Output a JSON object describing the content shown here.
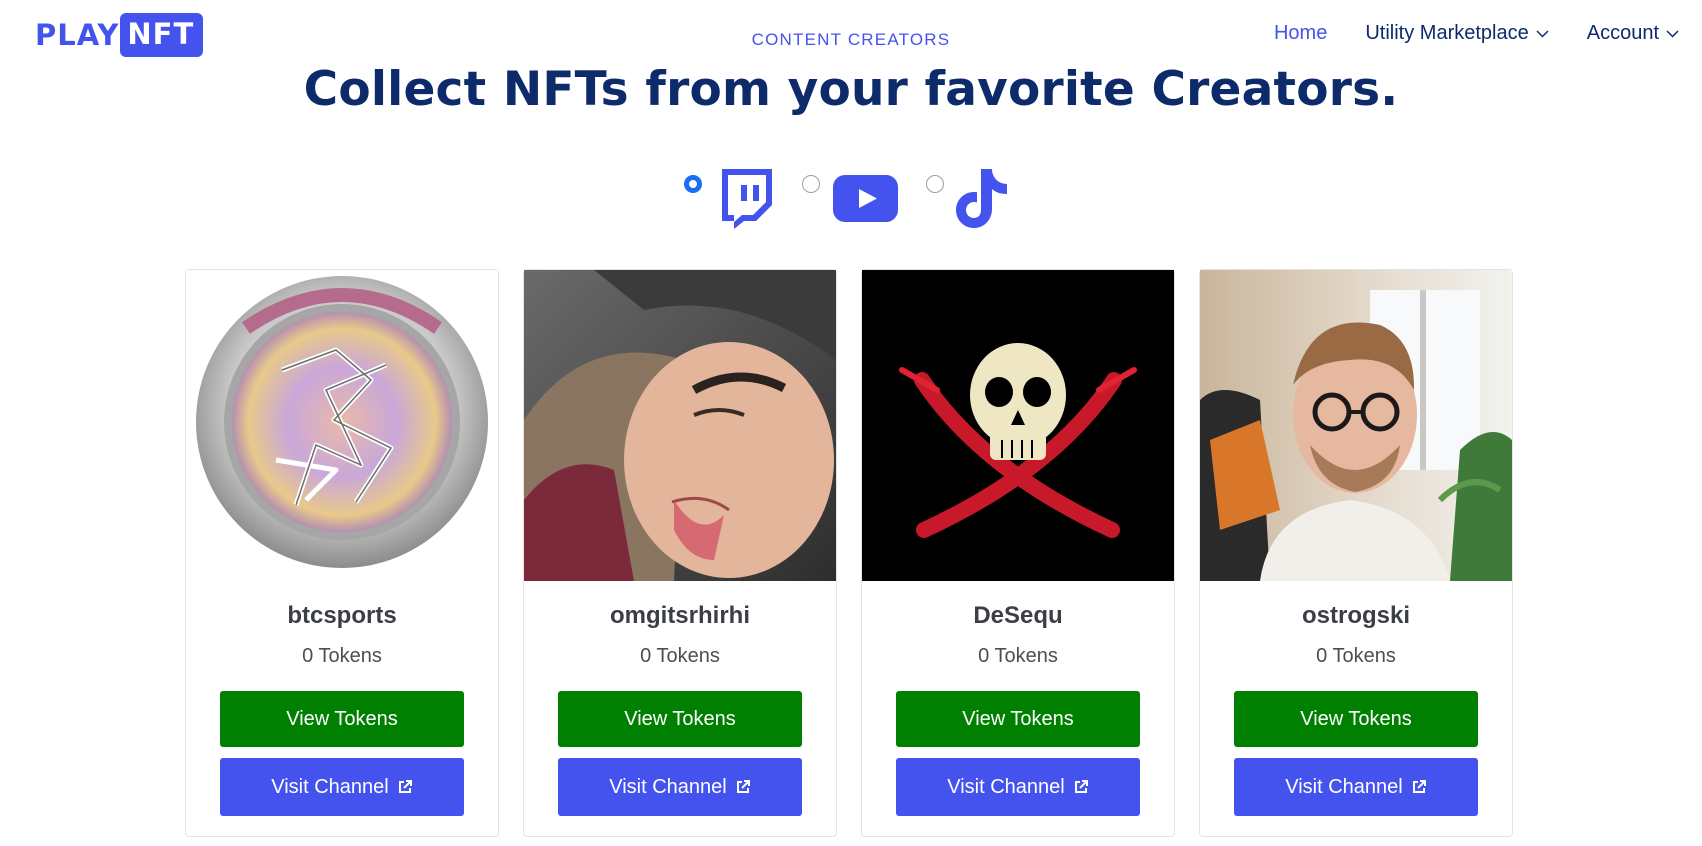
{
  "brand": {
    "logo_part1": "PLAY",
    "logo_part2": "NFT",
    "color": "#4453ee"
  },
  "header": {
    "eyebrow": "CONTENT CREATORS",
    "title": "Collect NFTs from your favorite Creators.",
    "nav": [
      {
        "label": "Home",
        "active": true
      },
      {
        "label": "Utility Marketplace",
        "icon": "chevron-down-icon"
      },
      {
        "label": "Account",
        "icon": "chevron-down-icon"
      }
    ]
  },
  "platforms": [
    {
      "name": "twitch",
      "icon": "twitch-icon",
      "selected": true
    },
    {
      "name": "youtube",
      "icon": "youtube-icon",
      "selected": false
    },
    {
      "name": "tiktok",
      "icon": "tiktok-icon",
      "selected": false
    }
  ],
  "creators": [
    {
      "name": "btcsports",
      "tokens": "0 Tokens",
      "view_label": "View Tokens",
      "visit_label": "Visit Channel"
    },
    {
      "name": "omgitsrhirhi",
      "tokens": "0 Tokens",
      "view_label": "View Tokens",
      "visit_label": "Visit Channel"
    },
    {
      "name": "DeSequ",
      "tokens": "0 Tokens",
      "view_label": "View Tokens",
      "visit_label": "Visit Channel"
    },
    {
      "name": "ostrogski",
      "tokens": "0 Tokens",
      "view_label": "View Tokens",
      "visit_label": "Visit Channel"
    }
  ],
  "colors": {
    "view_button": "#008000",
    "visit_button": "#4453ee",
    "heading": "#0d2b6b",
    "radio_checked": "#1a6ef5"
  }
}
